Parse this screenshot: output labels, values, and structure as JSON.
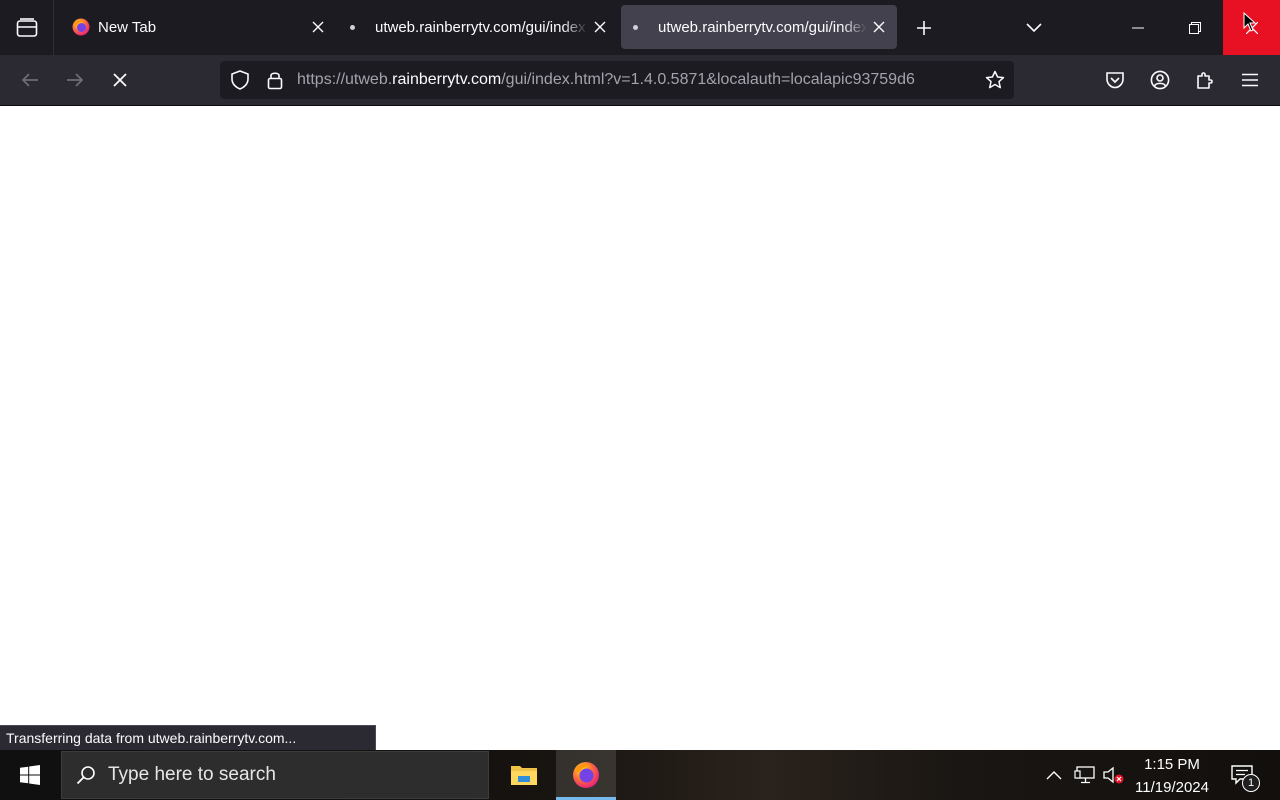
{
  "browser": {
    "tabs": [
      {
        "title": "New Tab",
        "icon": "firefox-logo-icon",
        "active": false
      },
      {
        "title": "utweb.rainberrytv.com/gui/index.html",
        "icon": "loading-dot-icon",
        "active": false
      },
      {
        "title": "utweb.rainberrytv.com/gui/index.html",
        "icon": "loading-dot-icon",
        "active": true
      }
    ],
    "url": {
      "prefix": "https://utweb.",
      "host": "rainberrytv.com",
      "path": "/gui/index.html?v=1.4.0.5871&localauth=localapic93759d6"
    },
    "status_text": "Transferring data from utweb.rainberrytv.com...",
    "colors": {
      "tabstrip": "#1c1b22",
      "toolbar": "#2b2a33",
      "active_tab": "#42414d",
      "close_hover": "#e81123"
    }
  },
  "taskbar": {
    "search_placeholder": "Type here to search",
    "time": "1:15 PM",
    "date": "11/19/2024",
    "notification_count": "1",
    "apps": [
      {
        "name": "file-explorer-icon"
      },
      {
        "name": "firefox-icon",
        "active": true
      }
    ]
  }
}
